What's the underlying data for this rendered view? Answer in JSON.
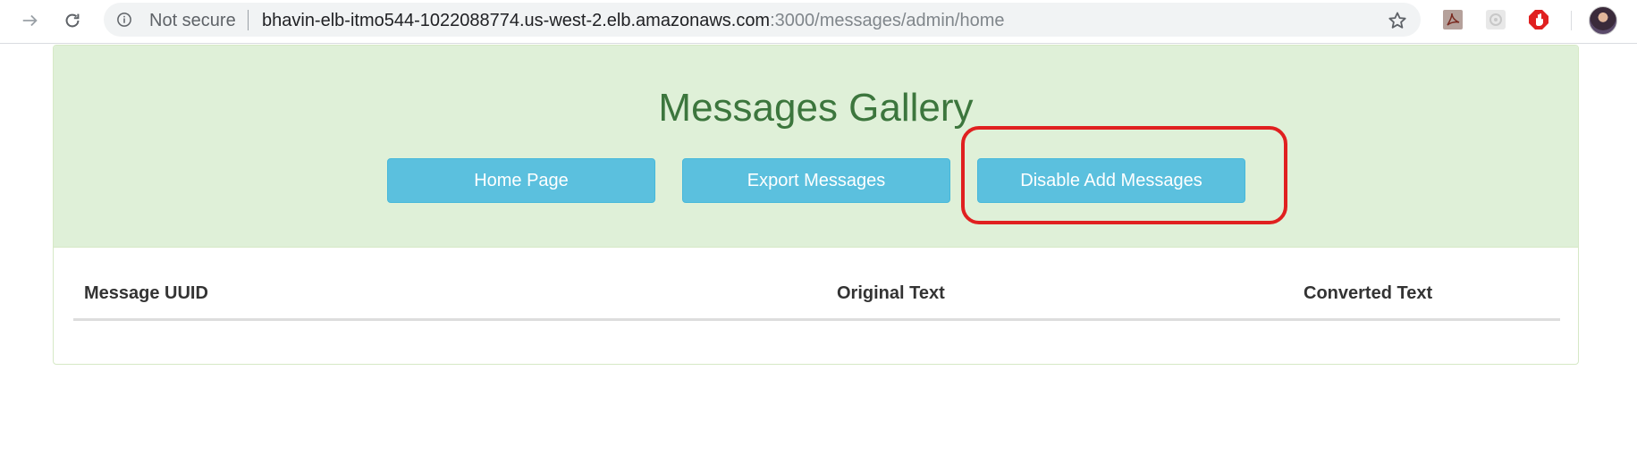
{
  "browser": {
    "security_label": "Not secure",
    "url_host": "bhavin-elb-itmo544-1022088774.us-west-2.elb.amazonaws.com",
    "url_path": ":3000/messages/admin/home",
    "icons": {
      "back": "back-arrow-icon",
      "reload": "reload-icon",
      "info": "info-icon",
      "bookmark": "star-icon",
      "ext_pdf": "pdf-extension-icon",
      "ext_generic": "extension-icon",
      "ext_adblock": "adblock-extension-icon"
    }
  },
  "page": {
    "title": "Messages Gallery",
    "buttons": {
      "home": "Home Page",
      "export": "Export Messages",
      "disable_add": "Disable Add Messages"
    },
    "table": {
      "columns": [
        "Message UUID",
        "Original Text",
        "Converted Text"
      ],
      "rows": []
    },
    "colors": {
      "heading_bg": "#dff0d8",
      "title": "#3c763d",
      "button": "#5bc0de",
      "highlight": "#e02020"
    }
  }
}
